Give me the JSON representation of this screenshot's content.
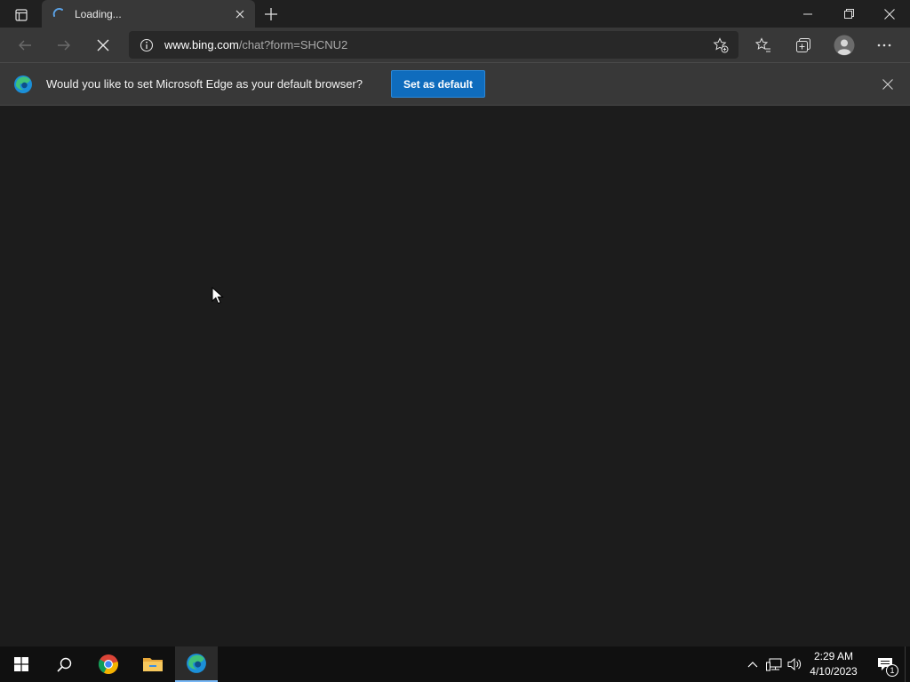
{
  "browser": {
    "tab": {
      "title": "Loading...",
      "icons": {
        "spinner": "loading-spinner-icon",
        "close": "close-icon"
      }
    },
    "window_controls": {
      "minimize": "minimize-icon",
      "restore": "restore-icon",
      "close": "close-icon"
    },
    "toolbar": {
      "url_host": "www.bing.com",
      "url_path": "/chat?form=SHCNU2",
      "icons": [
        "back-arrow-icon",
        "forward-arrow-icon",
        "stop-loading-icon",
        "site-info-icon",
        "add-favorite-icon",
        "favorites-icon",
        "collections-icon",
        "profile-avatar-icon",
        "more-menu-icon"
      ]
    },
    "infobar": {
      "message": "Would you like to set Microsoft Edge as your default browser?",
      "button_label": "Set as default"
    }
  },
  "taskbar": {
    "apps": [
      "windows-start-icon",
      "search-icon",
      "chrome-icon",
      "file-explorer-icon",
      "edge-icon"
    ],
    "time": "2:29 AM",
    "date": "4/10/2023",
    "notification_count": "1"
  },
  "colors": {
    "page_background": "#1c1c1c",
    "chrome_background": "#383838",
    "accent": "#0f6cbd"
  }
}
